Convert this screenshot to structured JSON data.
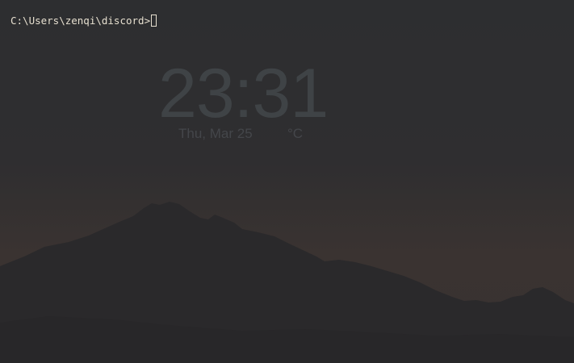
{
  "terminal": {
    "prompt": "C:\\Users\\zenqi\\discord>"
  },
  "clock": {
    "time": "23:31",
    "date": "Thu, Mar 25",
    "temperature_unit": "°C"
  },
  "colors": {
    "prompt_text": "#e6dfcf",
    "background": "#2d2e30",
    "mountain": "#2a292b",
    "clock_text": "#3f4346"
  }
}
